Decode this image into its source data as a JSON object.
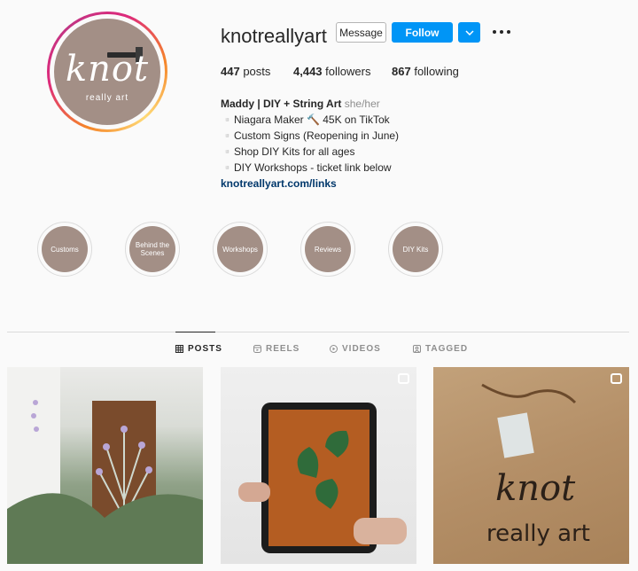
{
  "profile": {
    "avatar_logo_main": "knot",
    "avatar_logo_sub": "really art",
    "username": "knotreallyart",
    "message_label": "Message",
    "follow_label": "Follow"
  },
  "stats": {
    "posts_count": "447",
    "posts_label": "posts",
    "followers_count": "4,443",
    "followers_label": "followers",
    "following_count": "867",
    "following_label": "following"
  },
  "bio": {
    "name": "Maddy | DIY + String Art",
    "pronouns": "she/her",
    "lines": [
      "▫️Niagara Maker 🔨 45K on TikTok",
      "▫️Custom Signs (Reopening in June)",
      "▫️Shop DIY Kits for all ages",
      "▫️DIY Workshops - ticket link below"
    ],
    "link": "knotreallyart.com/links"
  },
  "highlights": [
    {
      "label": "Customs"
    },
    {
      "label": "Behind the Scenes"
    },
    {
      "label": "Workshops"
    },
    {
      "label": "Reviews"
    },
    {
      "label": "DIY Kits"
    }
  ],
  "tabs": [
    {
      "label": "POSTS",
      "icon": "grid-icon",
      "active": true
    },
    {
      "label": "REELS",
      "icon": "reels-icon",
      "active": false
    },
    {
      "label": "VIDEOS",
      "icon": "play-icon",
      "active": false
    },
    {
      "label": "TAGGED",
      "icon": "tag-icon",
      "active": false
    }
  ],
  "posts": [
    {
      "badge": ""
    },
    {
      "badge": "reel-icon"
    },
    {
      "badge": "carousel-icon"
    }
  ],
  "colors": {
    "accent": "#0095f6",
    "link": "#00376b",
    "highlight_fill": "#a38f86"
  }
}
